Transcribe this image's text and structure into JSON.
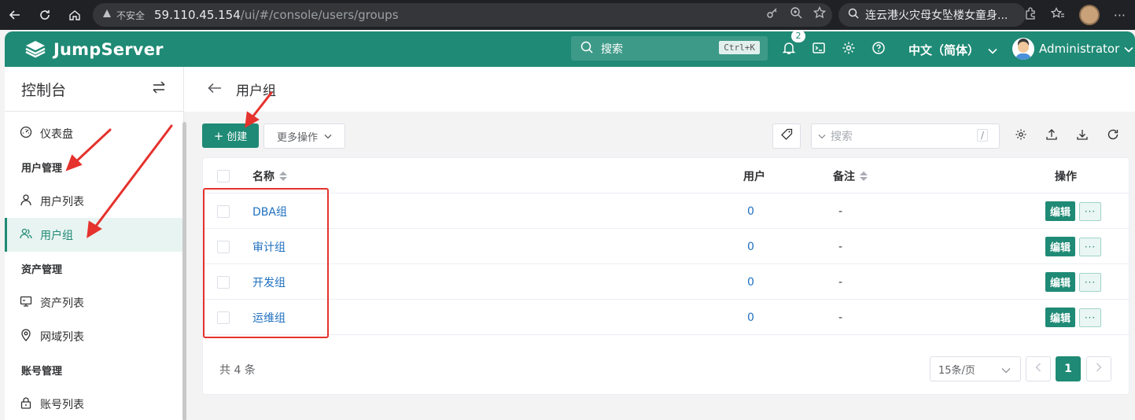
{
  "browser": {
    "insecure_label": "不安全",
    "url_host": "59.110.45.154",
    "url_path": "/ui/#/console/users/groups",
    "search_text": "连云港火灾母女坠楼女童身..."
  },
  "header": {
    "brand": "JumpServer",
    "search_placeholder": "搜索",
    "search_shortcut": "Ctrl+K",
    "notification_count": "2",
    "language": "中文（简体）",
    "username": "Administrator",
    "brand_color": "#1f8a75"
  },
  "sidebar": {
    "title": "控制台",
    "dashboard": "仪表盘",
    "groups": [
      {
        "label": "用户管理",
        "items": [
          "用户列表",
          "用户组"
        ]
      },
      {
        "label": "资产管理",
        "items": [
          "资产列表",
          "网域列表"
        ]
      },
      {
        "label": "账号管理",
        "items": [
          "账号列表"
        ]
      }
    ],
    "active_item": "用户组"
  },
  "page": {
    "title": "用户组"
  },
  "toolbar": {
    "create_label": "创建",
    "more_label": "更多操作",
    "search_placeholder": "搜索",
    "search_shortcut": "/"
  },
  "table": {
    "columns": {
      "name": "名称",
      "users": "用户",
      "comment": "备注",
      "actions": "操作"
    },
    "rows": [
      {
        "name": "DBA组",
        "users": "0",
        "comment": "-"
      },
      {
        "name": "审计组",
        "users": "0",
        "comment": "-"
      },
      {
        "name": "开发组",
        "users": "0",
        "comment": "-"
      },
      {
        "name": "运维组",
        "users": "0",
        "comment": "-"
      }
    ],
    "edit_label": "编辑",
    "more_label": "···"
  },
  "pagination": {
    "total": "共 4 条",
    "page_size": "15条/页",
    "current_page": "1"
  }
}
